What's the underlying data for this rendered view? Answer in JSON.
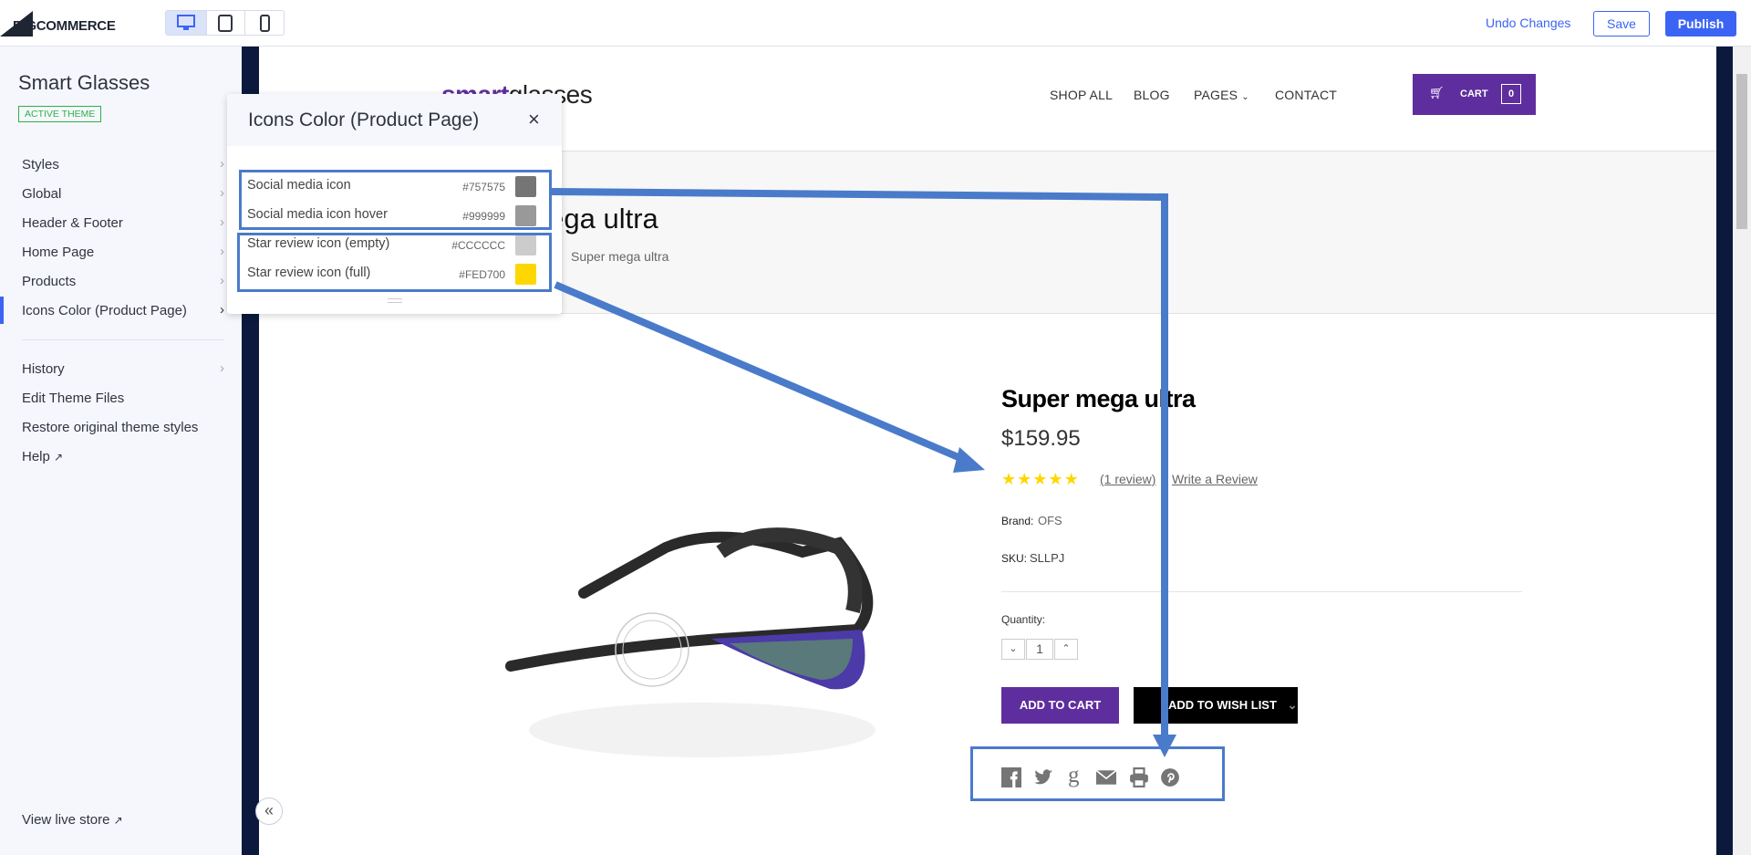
{
  "topbar": {
    "logo": "BIGCOMMERCE",
    "devices": [
      "desktop",
      "tablet",
      "mobile"
    ],
    "active_device": "desktop",
    "undo": "Undo Changes",
    "save": "Save",
    "publish": "Publish"
  },
  "sidebar": {
    "theme_name": "Smart Glasses",
    "badge": "ACTIVE THEME",
    "items": [
      {
        "label": "Styles"
      },
      {
        "label": "Global"
      },
      {
        "label": "Header & Footer"
      },
      {
        "label": "Home Page"
      },
      {
        "label": "Products"
      },
      {
        "label": "Icons Color (Product Page)",
        "active": true
      }
    ],
    "items2": [
      {
        "label": "History"
      },
      {
        "label": "Edit Theme Files"
      },
      {
        "label": "Restore original theme styles"
      },
      {
        "label": "Help"
      }
    ],
    "view_live": "View live store",
    "collapse": "«"
  },
  "panel": {
    "title": "Icons Color (Product Page)",
    "close": "×",
    "rows": [
      {
        "label": "Social media icon",
        "hex": "#757575"
      },
      {
        "label": "Social media icon hover",
        "hex": "#999999"
      },
      {
        "label": "Star review icon (empty)",
        "hex": "#CCCCCC"
      },
      {
        "label": "Star review icon (full)",
        "hex": "#FED700"
      }
    ]
  },
  "store": {
    "logo_a": "smart",
    "logo_b": "glasses",
    "nav": [
      "SHOP ALL",
      "BLOG",
      "PAGES",
      "CONTACT"
    ],
    "cart": "CART",
    "cart_count": "0",
    "page_heading": "Super mega ultra",
    "breadcrumb": "Super mega ultra",
    "product": {
      "title": "Super mega ultra",
      "price": "$159.95",
      "rating": 5,
      "reviews": "(1 review)",
      "write_review": "Write a Review",
      "brand_label": "Brand:",
      "brand": "OFS",
      "sku_label": "SKU:",
      "sku": "SLLPJ",
      "qty_label": "Quantity:",
      "qty": "1",
      "add_to_cart": "ADD TO CART",
      "wishlist": "ADD TO WISH LIST",
      "social": [
        "facebook",
        "twitter",
        "google-plus",
        "email",
        "print",
        "pinterest"
      ]
    }
  },
  "colors": {
    "accent": "#3c64f4",
    "store_purple": "#5f2e9e",
    "annotation": "#4a7bca",
    "star": "#FED700",
    "social": "#757575"
  }
}
